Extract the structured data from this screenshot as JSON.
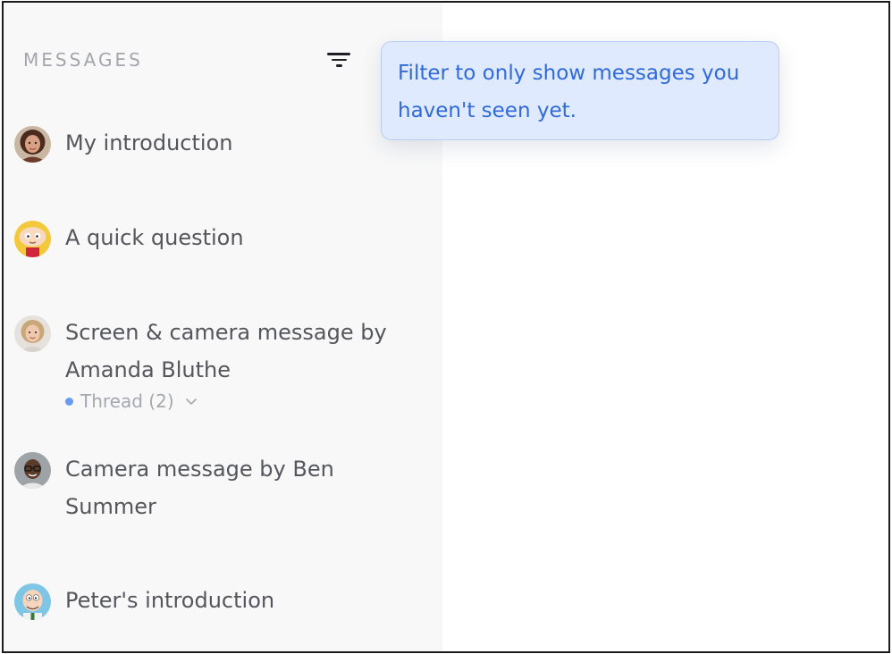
{
  "sidebar": {
    "header": "MESSAGES",
    "filter_icon": "filter-icon",
    "messages": [
      {
        "title": "My introduction",
        "avatar": "avatar-woman-curly-hair"
      },
      {
        "title": "A quick question",
        "avatar": "avatar-stewie-cartoon"
      },
      {
        "title": "Screen & camera message by Amanda Bluthe",
        "avatar": "avatar-woman-blonde",
        "thread": {
          "label": "Thread (2)",
          "icon": "chevron-down-icon"
        }
      },
      {
        "title": "Camera message by Ben Summer",
        "avatar": "avatar-man-glasses"
      },
      {
        "title": "Peter's introduction",
        "avatar": "avatar-peter-cartoon"
      }
    ]
  },
  "tooltip": {
    "text": "Filter to only show messages you haven't seen yet."
  },
  "colors": {
    "sidebar_bg": "#f8f8f8",
    "tooltip_bg": "#e0eaff",
    "tooltip_text": "#2f6ad8",
    "unread_dot": "#6a9af0"
  }
}
